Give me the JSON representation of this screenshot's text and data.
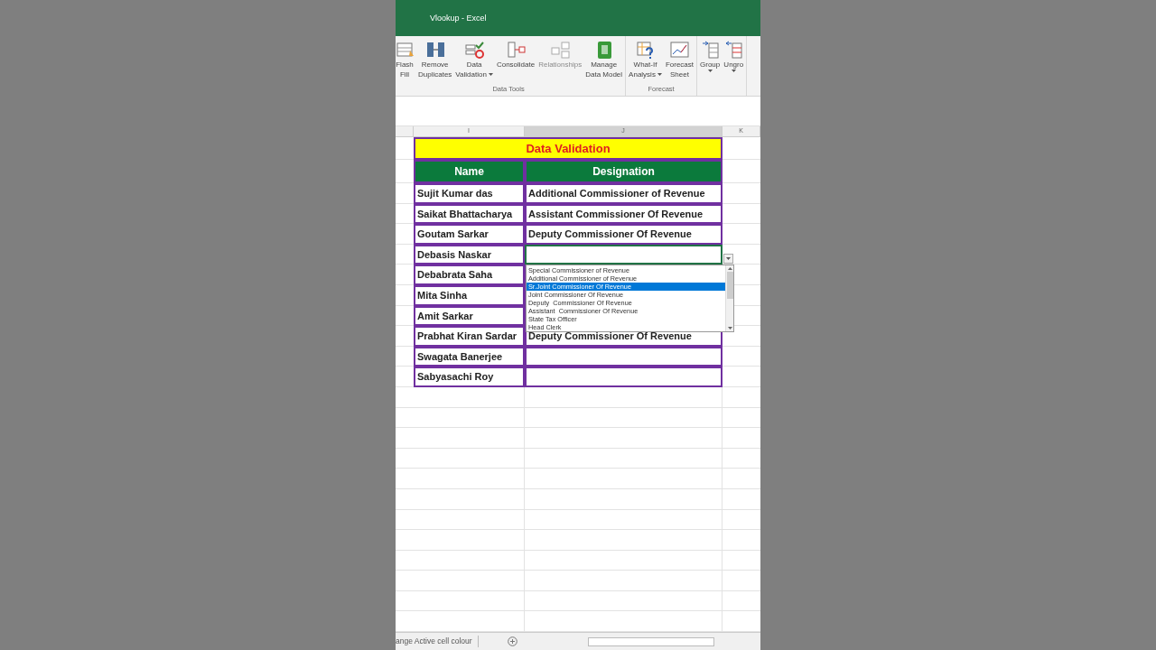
{
  "window": {
    "title": "Vlookup - Excel"
  },
  "ribbon": {
    "groups": [
      {
        "label": "Data Tools",
        "buttons": [
          {
            "lines": [
              "Flash",
              "Fill"
            ],
            "disabled": false,
            "dropdown": false
          },
          {
            "lines": [
              "Remove",
              "Duplicates"
            ],
            "disabled": false,
            "dropdown": false
          },
          {
            "lines": [
              "Data",
              "Validation"
            ],
            "disabled": false,
            "dropdown": true
          },
          {
            "lines": [
              "Consolidate"
            ],
            "disabled": false,
            "dropdown": false
          },
          {
            "lines": [
              "Relationships"
            ],
            "disabled": true,
            "dropdown": false
          },
          {
            "lines": [
              "Manage",
              "Data Model"
            ],
            "disabled": false,
            "dropdown": false
          }
        ]
      },
      {
        "label": "Forecast",
        "buttons": [
          {
            "lines": [
              "What-If",
              "Analysis"
            ],
            "disabled": false,
            "dropdown": true
          },
          {
            "lines": [
              "Forecast",
              "Sheet"
            ],
            "disabled": false,
            "dropdown": false
          }
        ]
      },
      {
        "buttons": [
          {
            "lines": [
              "Group"
            ],
            "disabled": false,
            "dropdown": true
          },
          {
            "lines": [
              "Ungro"
            ],
            "disabled": false,
            "dropdown": true
          }
        ]
      }
    ]
  },
  "columns": [
    {
      "label": "I",
      "selected": false
    },
    {
      "label": "J",
      "selected": true
    },
    {
      "label": "K",
      "selected": false
    }
  ],
  "table": {
    "title": "Data Validation",
    "headers": [
      "Name",
      "Designation"
    ],
    "rows": [
      {
        "name": "Sujit Kumar das",
        "designation": "Additional Commissioner of Revenue",
        "active": false
      },
      {
        "name": "Saikat Bhattacharya",
        "designation": "Assistant  Commissioner Of Revenue",
        "active": false
      },
      {
        "name": "Goutam Sarkar",
        "designation": "Deputy  Commissioner Of Revenue",
        "active": false
      },
      {
        "name": "Debasis Naskar",
        "active": true
      },
      {
        "name": "Debabrata Saha",
        "active": false
      },
      {
        "name": "Mita Sinha",
        "active": false
      },
      {
        "name": "Amit Sarkar",
        "active": false
      },
      {
        "name": "Prabhat Kiran Sardar",
        "designation": "Deputy  Commissioner Of Revenue",
        "active": false
      },
      {
        "name": "Swagata Banerjee",
        "active": false
      },
      {
        "name": "Sabyasachi  Roy",
        "active": false
      }
    ]
  },
  "dropdown": {
    "options": [
      {
        "label": "Special Commissioner of Revenue",
        "selected": false
      },
      {
        "label": "Additional Commissioner of Revenue",
        "selected": false
      },
      {
        "label": "Sr.Joint Commissioner Of Revenue",
        "selected": true
      },
      {
        "label": "Joint Commissioner Of Revenue",
        "selected": false
      },
      {
        "label": "Deputy  Commissioner Of Revenue",
        "selected": false
      },
      {
        "label": "Assistant  Commissioner Of Revenue",
        "selected": false
      },
      {
        "label": "State Tax Officer",
        "selected": false
      },
      {
        "label": "Head Clerk",
        "selected": false
      }
    ]
  },
  "status_bar": {
    "sheet_tab": "ange Active cell colour"
  }
}
